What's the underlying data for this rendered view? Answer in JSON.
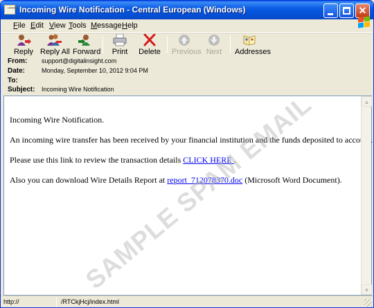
{
  "window": {
    "title": "Incoming Wire Notification - Central European (Windows)",
    "title_bar_color": "#0a5be4"
  },
  "menu": {
    "items": [
      {
        "label": "File",
        "accel": "F",
        "rest": "ile"
      },
      {
        "label": "Edit",
        "accel": "E",
        "rest": "dit"
      },
      {
        "label": "View",
        "accel": "V",
        "rest": "iew"
      },
      {
        "label": "Tools",
        "accel": "T",
        "rest": "ools"
      },
      {
        "label": "Message",
        "accel": "M",
        "rest": "essage"
      },
      {
        "label": "Help",
        "accel": "H",
        "rest": "elp"
      }
    ]
  },
  "toolbar": {
    "reply": "Reply",
    "reply_all": "Reply All",
    "forward": "Forward",
    "print": "Print",
    "delete": "Delete",
    "previous": "Previous",
    "next": "Next",
    "addresses": "Addresses"
  },
  "header": {
    "from_label": "From:",
    "from_value": "support@digitalinsight.com",
    "date_label": "Date:",
    "date_value": "Monday, September 10, 2012 9:04 PM",
    "to_label": "To:",
    "to_value": "",
    "subject_label": "Subject:",
    "subject_value": "Incoming Wire Notification"
  },
  "message": {
    "line1": "Incoming Wire Notification.",
    "line2": "An incoming wire transfer has been received by your financial institution and the funds deposited to account.",
    "line3_text": "Please use this link to review the transaction details ",
    "line3_link": "CLICK HERE ",
    "line3_end": ".",
    "line4_text": "Also you can download Wire Details Report at ",
    "line4_link": "report_712078370.doc",
    "line4_end": " (Microsoft Word Document)."
  },
  "watermark": "SAMPLE SPAM EMAIL",
  "status": {
    "left": "http://",
    "url": "/RTCkjHcj/index.html"
  }
}
